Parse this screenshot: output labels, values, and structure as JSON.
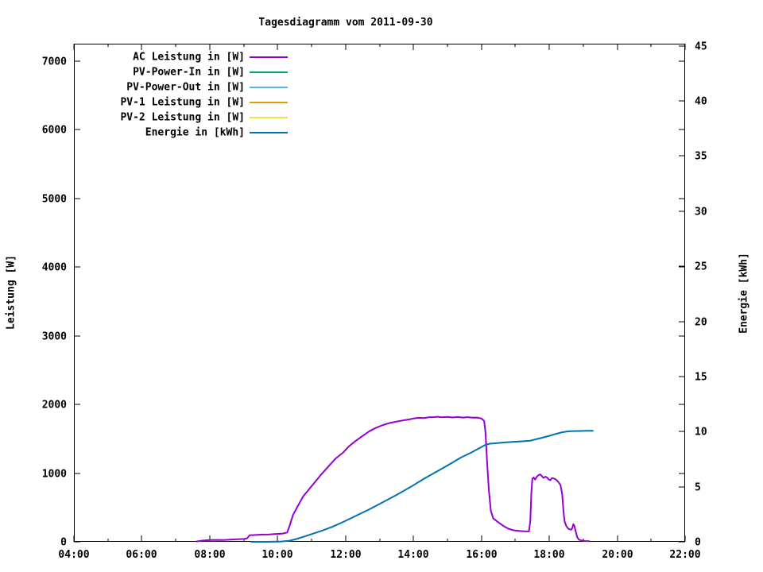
{
  "title": "Tagesdiagramm vom 2011-09-30",
  "chart_data": {
    "type": "line",
    "title": "Tagesdiagramm vom 2011-09-30",
    "grid": false,
    "legend_position": "top-left-inside",
    "x_axis": {
      "min": 4,
      "max": 22,
      "major_ticks": [
        {
          "t": 4,
          "label": "04:00"
        },
        {
          "t": 6,
          "label": "06:00"
        },
        {
          "t": 8,
          "label": "08:00"
        },
        {
          "t": 10,
          "label": "10:00"
        },
        {
          "t": 12,
          "label": "12:00"
        },
        {
          "t": 14,
          "label": "14:00"
        },
        {
          "t": 16,
          "label": "16:00"
        },
        {
          "t": 18,
          "label": "18:00"
        },
        {
          "t": 20,
          "label": "20:00"
        },
        {
          "t": 22,
          "label": "22:00"
        }
      ],
      "minor_ticks": [
        5,
        7,
        9,
        11,
        13,
        15,
        17,
        19,
        21
      ]
    },
    "y_left": {
      "title": "Leistung [W]",
      "min": 0,
      "max": 7250,
      "ticks": [
        0,
        1000,
        2000,
        3000,
        4000,
        5000,
        6000,
        7000
      ]
    },
    "y_right": {
      "title": "Energie [kWh]",
      "min": 0,
      "max": 45.2,
      "ticks": [
        0,
        5,
        10,
        15,
        20,
        25,
        30,
        35,
        40,
        45
      ]
    },
    "legend": [
      {
        "label": "AC Leistung in [W]",
        "color": "#9400d3"
      },
      {
        "label": "PV-Power-In in [W]",
        "color": "#009e73"
      },
      {
        "label": "PV-Power-Out in [W]",
        "color": "#56b4e9"
      },
      {
        "label": "PV-1 Leistung in [W]",
        "color": "#e69f00"
      },
      {
        "label": "PV-2 Leistung in [W]",
        "color": "#f0e442"
      },
      {
        "label": "Energie in [kWh]",
        "color": "#0072b2"
      }
    ],
    "series": [
      {
        "name": "AC Leistung in [W]",
        "id": "ac-leistung",
        "axis": "left",
        "color": "#9400d3",
        "points": [
          [
            7.6,
            5
          ],
          [
            7.8,
            18
          ],
          [
            8.0,
            25
          ],
          [
            8.2,
            28
          ],
          [
            8.4,
            26
          ],
          [
            8.6,
            32
          ],
          [
            8.8,
            38
          ],
          [
            9.0,
            42
          ],
          [
            9.1,
            50
          ],
          [
            9.17,
            95
          ],
          [
            9.35,
            100
          ],
          [
            9.55,
            105
          ],
          [
            9.75,
            108
          ],
          [
            9.95,
            114
          ],
          [
            10.15,
            120
          ],
          [
            10.28,
            135
          ],
          [
            10.35,
            230
          ],
          [
            10.45,
            390
          ],
          [
            10.55,
            480
          ],
          [
            10.65,
            570
          ],
          [
            10.75,
            660
          ],
          [
            10.9,
            750
          ],
          [
            11.1,
            870
          ],
          [
            11.3,
            990
          ],
          [
            11.5,
            1100
          ],
          [
            11.7,
            1210
          ],
          [
            11.93,
            1300
          ],
          [
            12.1,
            1390
          ],
          [
            12.3,
            1470
          ],
          [
            12.5,
            1540
          ],
          [
            12.7,
            1610
          ],
          [
            12.9,
            1660
          ],
          [
            13.1,
            1700
          ],
          [
            13.3,
            1730
          ],
          [
            13.5,
            1750
          ],
          [
            13.7,
            1768
          ],
          [
            13.85,
            1780
          ],
          [
            14.0,
            1795
          ],
          [
            14.15,
            1805
          ],
          [
            14.3,
            1800
          ],
          [
            14.45,
            1812
          ],
          [
            14.6,
            1815
          ],
          [
            14.7,
            1820
          ],
          [
            14.85,
            1812
          ],
          [
            15.0,
            1818
          ],
          [
            15.15,
            1810
          ],
          [
            15.3,
            1817
          ],
          [
            15.45,
            1808
          ],
          [
            15.6,
            1814
          ],
          [
            15.75,
            1806
          ],
          [
            15.88,
            1808
          ],
          [
            16.0,
            1795
          ],
          [
            16.08,
            1760
          ],
          [
            16.12,
            1600
          ],
          [
            16.17,
            1150
          ],
          [
            16.22,
            750
          ],
          [
            16.28,
            450
          ],
          [
            16.35,
            340
          ],
          [
            16.5,
            285
          ],
          [
            16.65,
            230
          ],
          [
            16.8,
            190
          ],
          [
            16.95,
            168
          ],
          [
            17.1,
            158
          ],
          [
            17.25,
            154
          ],
          [
            17.4,
            152
          ],
          [
            17.44,
            300
          ],
          [
            17.47,
            700
          ],
          [
            17.5,
            920
          ],
          [
            17.54,
            935
          ],
          [
            17.58,
            905
          ],
          [
            17.63,
            945
          ],
          [
            17.68,
            970
          ],
          [
            17.73,
            982
          ],
          [
            17.78,
            958
          ],
          [
            17.83,
            930
          ],
          [
            17.88,
            948
          ],
          [
            17.93,
            938
          ],
          [
            17.98,
            908
          ],
          [
            18.03,
            896
          ],
          [
            18.08,
            928
          ],
          [
            18.13,
            922
          ],
          [
            18.18,
            912
          ],
          [
            18.23,
            892
          ],
          [
            18.28,
            862
          ],
          [
            18.33,
            828
          ],
          [
            18.38,
            700
          ],
          [
            18.4,
            560
          ],
          [
            18.42,
            430
          ],
          [
            18.45,
            300
          ],
          [
            18.5,
            230
          ],
          [
            18.55,
            195
          ],
          [
            18.6,
            180
          ],
          [
            18.65,
            178
          ],
          [
            18.68,
            205
          ],
          [
            18.71,
            258
          ],
          [
            18.74,
            230
          ],
          [
            18.78,
            150
          ],
          [
            18.82,
            70
          ],
          [
            18.87,
            32
          ],
          [
            18.95,
            18
          ],
          [
            19.05,
            12
          ],
          [
            19.19,
            9
          ]
        ]
      },
      {
        "name": "Energie in [kWh]",
        "id": "energie",
        "axis": "right",
        "color": "#0072b2",
        "points": [
          [
            9.2,
            0
          ],
          [
            9.7,
            0
          ],
          [
            10.1,
            0.03
          ],
          [
            10.35,
            0.1
          ],
          [
            10.55,
            0.25
          ],
          [
            10.75,
            0.45
          ],
          [
            11.0,
            0.7
          ],
          [
            11.3,
            1.0
          ],
          [
            11.6,
            1.35
          ],
          [
            11.93,
            1.8
          ],
          [
            12.3,
            2.35
          ],
          [
            12.7,
            2.95
          ],
          [
            13.1,
            3.6
          ],
          [
            13.5,
            4.25
          ],
          [
            13.9,
            4.95
          ],
          [
            14.3,
            5.7
          ],
          [
            14.7,
            6.4
          ],
          [
            15.1,
            7.1
          ],
          [
            15.4,
            7.65
          ],
          [
            15.68,
            8.07
          ],
          [
            16.0,
            8.6
          ],
          [
            16.12,
            8.8
          ],
          [
            16.25,
            8.9
          ],
          [
            16.45,
            8.96
          ],
          [
            16.7,
            9.02
          ],
          [
            17.0,
            9.08
          ],
          [
            17.25,
            9.13
          ],
          [
            17.44,
            9.18
          ],
          [
            17.6,
            9.3
          ],
          [
            17.8,
            9.45
          ],
          [
            18.0,
            9.62
          ],
          [
            18.2,
            9.8
          ],
          [
            18.35,
            9.92
          ],
          [
            18.45,
            9.98
          ],
          [
            18.55,
            10.02
          ],
          [
            18.7,
            10.05
          ],
          [
            18.9,
            10.06
          ],
          [
            19.1,
            10.07
          ],
          [
            19.3,
            10.07
          ]
        ]
      }
    ]
  }
}
